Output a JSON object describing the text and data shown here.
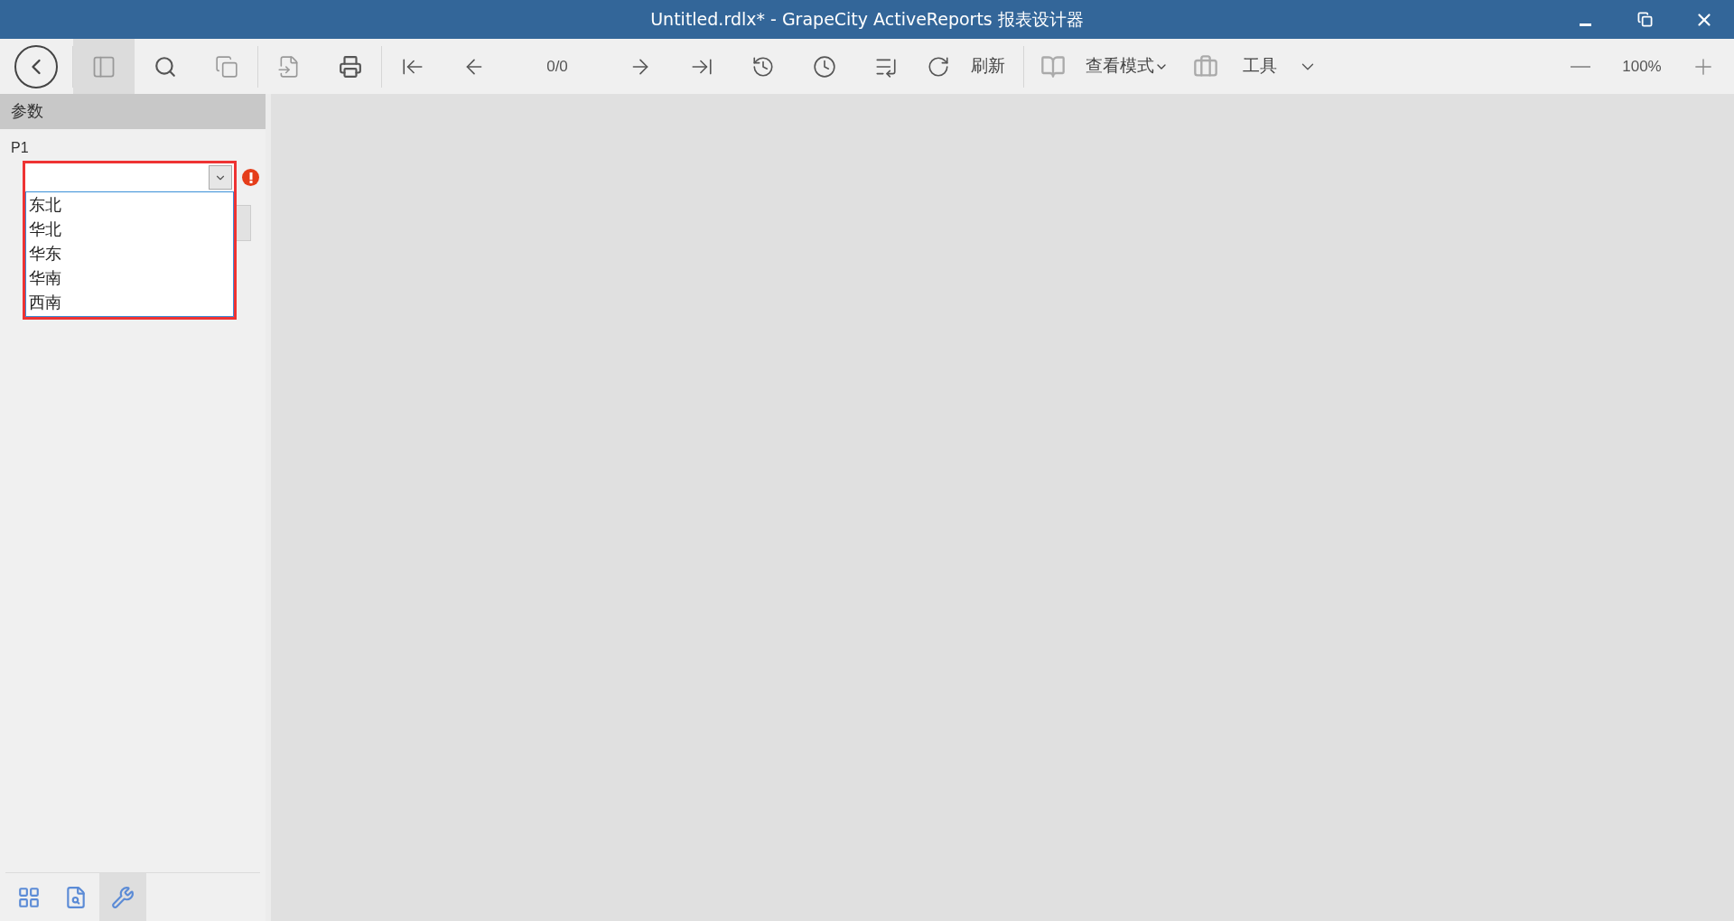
{
  "window": {
    "title": "Untitled.rdlx* - GrapeCity ActiveReports 报表设计器"
  },
  "toolbar": {
    "sidebar_toggle": {
      "selected": true
    },
    "page_display": "0/0",
    "refresh_label": "刷新",
    "view_mode_label": "查看模式",
    "tools_label": "工具",
    "zoom": "100%"
  },
  "sidebar": {
    "header": "参数",
    "parameter": {
      "label": "P1",
      "value_invalid": true,
      "dropdown_open": true,
      "options": [
        "东北",
        "华北",
        "华东",
        "华南",
        "西南"
      ]
    },
    "bottom_tabs": [
      {
        "selected": false
      },
      {
        "selected": false
      },
      {
        "selected": true
      }
    ]
  }
}
